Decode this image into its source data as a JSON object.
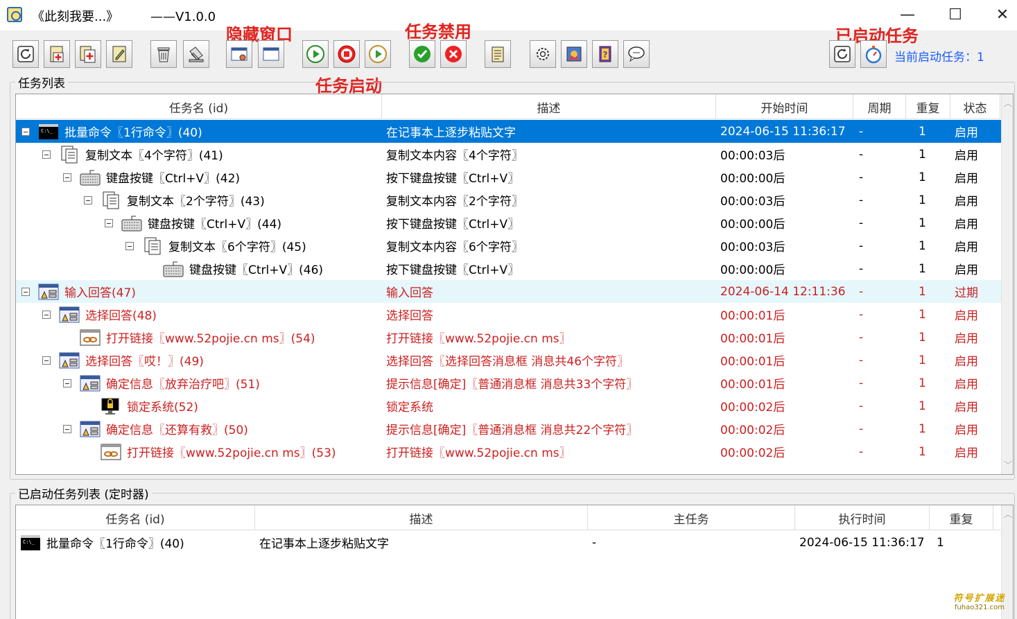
{
  "window": {
    "title": "《此刻我要...》",
    "version": "——V1.0.0",
    "minimize_glyph": "—",
    "maximize_glyph": "☐",
    "close_glyph": "✕"
  },
  "annotations": {
    "hide_window": "隐藏窗口",
    "task_disable": "任务禁用",
    "task_start": "任务启动",
    "started_tasks": "已启动任务"
  },
  "toolbar": {
    "buttons": [
      "refresh-icon",
      "add-task-icon",
      "add-subtask-icon",
      "edit-task-icon",
      "delete-icon",
      "clear-icon",
      "hide-window-icon",
      "show-window-icon",
      "play-icon",
      "stop-icon",
      "play-outline-icon",
      "enable-icon",
      "disable-icon",
      "notes-icon",
      "gear-icon",
      "picture-icon",
      "help-icon",
      "chat-icon",
      "started-refresh-icon",
      "stopwatch-icon"
    ],
    "current_started_tasks": "当前启动任务：1"
  },
  "task_list": {
    "group_label": "任务列表",
    "columns": [
      "任务名 (id)",
      "描述",
      "开始时间",
      "周期",
      "重复",
      "状态"
    ],
    "rows": [
      {
        "name": "批量命令〖1行命令〗(40)",
        "desc": "在记事本上逐步粘贴文字",
        "start": "2024-06-15 11:36:17",
        "period": "-",
        "repeat": "1",
        "status": "启用",
        "icon": "cmd-icon"
      },
      {
        "name": "复制文本〖4个字符〗(41)",
        "desc": "复制文本内容〖4个字符〗",
        "start": "00:00:03后",
        "period": "-",
        "repeat": "1",
        "status": "启用",
        "icon": "copy-text-icon"
      },
      {
        "name": "键盘按键〖Ctrl+V〗(42)",
        "desc": "按下键盘按键〖Ctrl+V〗",
        "start": "00:00:00后",
        "period": "-",
        "repeat": "1",
        "status": "启用",
        "icon": "keyboard-icon"
      },
      {
        "name": "复制文本〖2个字符〗(43)",
        "desc": "复制文本内容〖2个字符〗",
        "start": "00:00:03后",
        "period": "-",
        "repeat": "1",
        "status": "启用",
        "icon": "copy-text-icon"
      },
      {
        "name": "键盘按键〖Ctrl+V〗(44)",
        "desc": "按下键盘按键〖Ctrl+V〗",
        "start": "00:00:00后",
        "period": "-",
        "repeat": "1",
        "status": "启用",
        "icon": "keyboard-icon"
      },
      {
        "name": "复制文本〖6个字符〗(45)",
        "desc": "复制文本内容〖6个字符〗",
        "start": "00:00:03后",
        "period": "-",
        "repeat": "1",
        "status": "启用",
        "icon": "copy-text-icon"
      },
      {
        "name": "键盘按键〖Ctrl+V〗(46)",
        "desc": "按下键盘按键〖Ctrl+V〗",
        "start": "00:00:00后",
        "period": "-",
        "repeat": "1",
        "status": "启用",
        "icon": "keyboard-icon"
      },
      {
        "name": "输入回答(47)",
        "desc": "输入回答",
        "start": "2024-06-14 12:11:36",
        "period": "-",
        "repeat": "1",
        "status": "过期",
        "icon": "dialog-icon"
      },
      {
        "name": "选择回答(48)",
        "desc": "选择回答",
        "start": "00:00:01后",
        "period": "-",
        "repeat": "1",
        "status": "启用",
        "icon": "dialog-icon"
      },
      {
        "name": "打开链接〖www.52pojie.cn ms〗(54)",
        "desc": "打开链接〖www.52pojie.cn ms〗",
        "start": "00:00:01后",
        "period": "-",
        "repeat": "1",
        "status": "启用",
        "icon": "link-icon"
      },
      {
        "name": "选择回答〖哎！〗(49)",
        "desc": "选择回答〖选择回答消息框 消息共46个字符〗",
        "start": "00:00:01后",
        "period": "-",
        "repeat": "1",
        "status": "启用",
        "icon": "dialog-icon"
      },
      {
        "name": "确定信息〖放弃治疗吧〗(51)",
        "desc": "提示信息[确定]〖普通消息框 消息共33个字符〗",
        "start": "00:00:01后",
        "period": "-",
        "repeat": "1",
        "status": "启用",
        "icon": "dialog-icon"
      },
      {
        "name": "锁定系统(52)",
        "desc": "锁定系统",
        "start": "00:00:02后",
        "period": "-",
        "repeat": "1",
        "status": "启用",
        "icon": "lock-icon"
      },
      {
        "name": "确定信息〖还算有救〗(50)",
        "desc": "提示信息[确定]〖普通消息框 消息共22个字符〗",
        "start": "00:00:02后",
        "period": "-",
        "repeat": "1",
        "status": "启用",
        "icon": "dialog-icon"
      },
      {
        "name": "打开链接〖www.52pojie.cn ms〗(53)",
        "desc": "打开链接〖www.52pojie.cn ms〗",
        "start": "00:00:02后",
        "period": "-",
        "repeat": "1",
        "status": "启用",
        "icon": "link-icon"
      }
    ]
  },
  "started_list": {
    "group_label": "已启动任务列表 (定时器)",
    "columns": [
      "任务名 (id)",
      "描述",
      "主任务",
      "执行时间",
      "重复"
    ],
    "rows": [
      {
        "name": "批量命令〖1行命令〗(40)",
        "desc": "在记事本上逐步粘贴文字",
        "main": "-",
        "time": "2024-06-15 11:36:17",
        "repeat": "1",
        "icon": "cmd-icon"
      }
    ]
  },
  "watermark": {
    "main": "符号扩展迷",
    "sub": "fuhao321.com"
  },
  "colors": {
    "selection": "#0078d7",
    "expired_text": "#cc1f1f",
    "highlight_row": "#e6f7fc",
    "annotation": "#e0241f",
    "status_link": "#1a5cff"
  }
}
